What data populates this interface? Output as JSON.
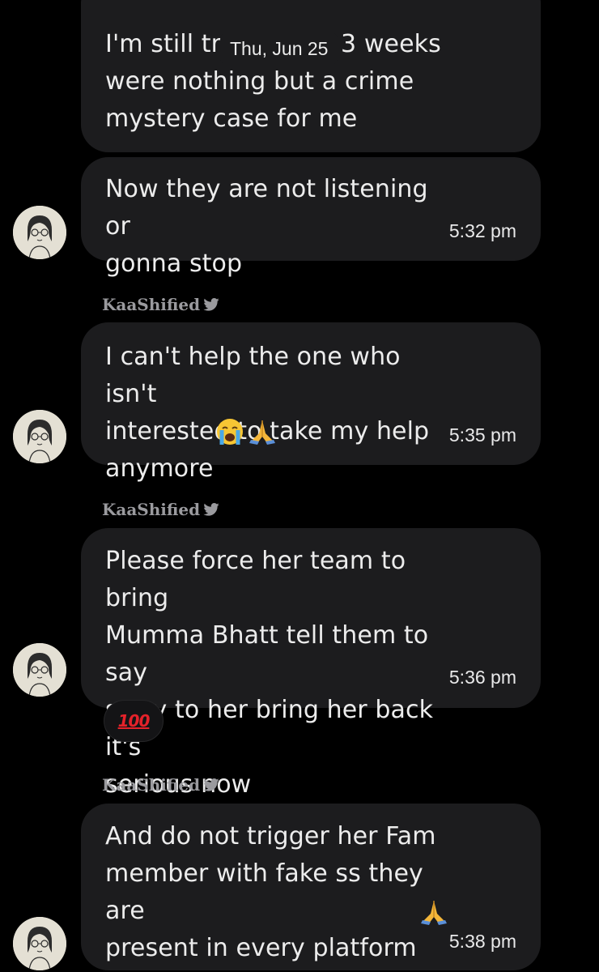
{
  "date_header": "Thu, Jun 25",
  "sender_name": "KaaShified",
  "messages": [
    {
      "text": "I'm still trying, last 3 weeks\nwere nothing but a crime\nmystery case for me",
      "time": ""
    },
    {
      "text": "Now they are not listening or\ngonna stop",
      "time": "5:32 pm"
    },
    {
      "text": "I can't help the one who isn't\ninterested to take my help\nanymore",
      "time": "5:35 pm",
      "emojis": [
        "crying-face",
        "folded-hands"
      ]
    },
    {
      "text": "Please force her team to bring\nMumma Bhatt tell them to say\nsorry to her bring her back it's\nserious now",
      "time": "5:36 pm",
      "reaction": "100"
    },
    {
      "text": "And do not trigger her Fam\nmember with fake ss they are\npresent in every platform",
      "time": "5:38 pm",
      "emojis": [
        "folded-hands"
      ]
    }
  ],
  "colors": {
    "background": "#000000",
    "bubble": "#1c1c1e",
    "text": "#ececec",
    "sender": "#9a9a9e",
    "reaction": "#e5222a"
  },
  "icons": {
    "verified": "twitter-bird-icon",
    "avatar": "avatar-illustration"
  }
}
